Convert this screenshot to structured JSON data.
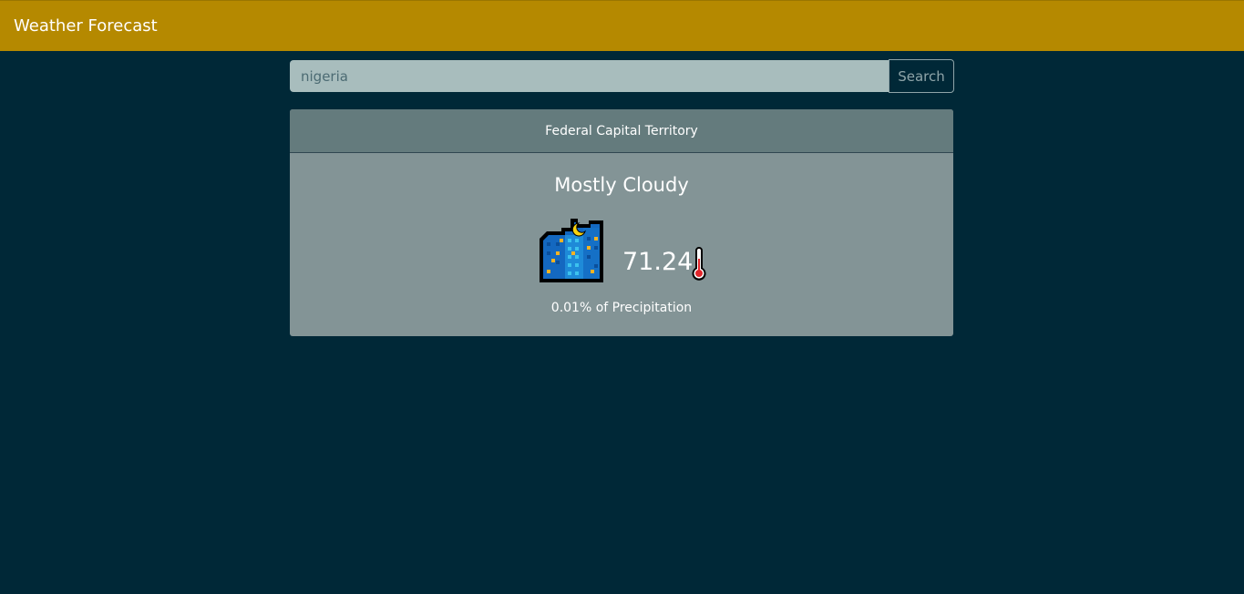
{
  "navbar": {
    "brand": "Weather Forecast",
    "bg_color": "#b58900"
  },
  "search": {
    "value": "nigeria",
    "button_label": "Search"
  },
  "forecast": {
    "location": "Federal Capital Territory",
    "condition": "Mostly Cloudy",
    "condition_icon": "night-city-icon",
    "temperature": "71.24",
    "temperature_icon": "thermometer-icon",
    "precipitation": "0.01",
    "precipitation_suffix": "% of Precipitation"
  },
  "colors": {
    "page_bg": "#002837",
    "card_bg": "#839496",
    "card_header_bg": "#647b7d"
  }
}
